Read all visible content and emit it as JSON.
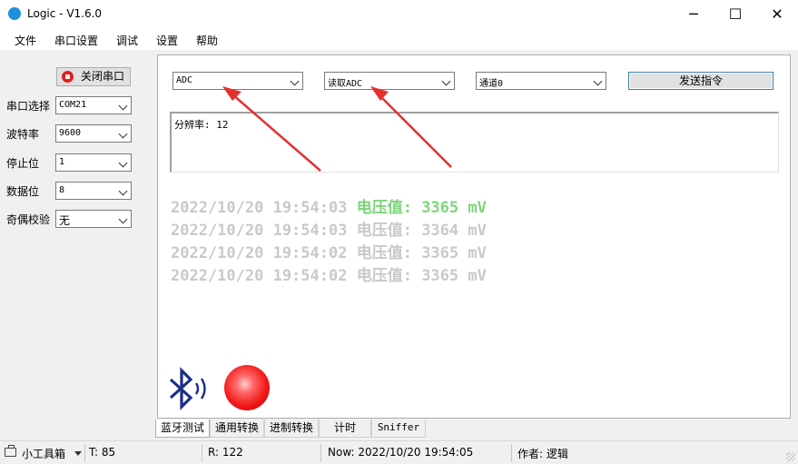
{
  "window": {
    "title": "Logic - V1.6.0",
    "minimize_glyph": "─",
    "maximize_glyph": "☐",
    "close_glyph": "✕"
  },
  "menu": {
    "items": [
      {
        "label": "文件"
      },
      {
        "label": "串口设置"
      },
      {
        "label": "调试"
      },
      {
        "label": "设置"
      },
      {
        "label": "帮助"
      }
    ]
  },
  "serial": {
    "close_button_label": "关闭串口",
    "fields": [
      {
        "label": "串口选择",
        "value": "COM21"
      },
      {
        "label": "波特率",
        "value": "9600"
      },
      {
        "label": "停止位",
        "value": "1"
      },
      {
        "label": "数据位",
        "value": "8"
      },
      {
        "label": "奇偶校验",
        "value": "无"
      }
    ]
  },
  "command": {
    "device": "ADC",
    "action": "读取ADC",
    "channel": "通道0",
    "send_label": "发送指令"
  },
  "result": {
    "text": "分辨率: 12"
  },
  "log": [
    {
      "time": "2022/10/20 19:54:03",
      "reading": "电压值: 3365 mV",
      "fresh": true
    },
    {
      "time": "2022/10/20 19:54:03",
      "reading": "电压值: 3364 mV",
      "fresh": false
    },
    {
      "time": "2022/10/20 19:54:02",
      "reading": "电压值: 3365 mV",
      "fresh": false
    },
    {
      "time": "2022/10/20 19:54:02",
      "reading": "电压值: 3365 mV",
      "fresh": false
    }
  ],
  "tabs": [
    {
      "label": "蓝牙测试",
      "active": true
    },
    {
      "label": "通用转换",
      "active": false
    },
    {
      "label": "进制转换",
      "active": false
    },
    {
      "label": "计时",
      "active": false
    },
    {
      "label": "Sniffer",
      "active": false
    }
  ],
  "status": {
    "toolbox_label": "小工具箱",
    "tx": "T: 85",
    "rx": "R: 122",
    "now": "Now:  2022/10/20 19:54:05",
    "author": "作者: 逻辑"
  },
  "colors": {
    "accent_blue": "#1e8fde",
    "indicator_red": "#f01818",
    "fresh_reading_green": "#7bd67b",
    "old_log_gray": "#c9c9c9",
    "annotation_arrow_red": "#e53030",
    "bluetooth_blue": "#1a2f8a"
  },
  "icons": {
    "app": "app-logo-icon",
    "close_port": "stop-icon",
    "bluetooth": "bluetooth-icon",
    "status_light": "status-light-icon",
    "toolbox": "toolbox-icon"
  }
}
